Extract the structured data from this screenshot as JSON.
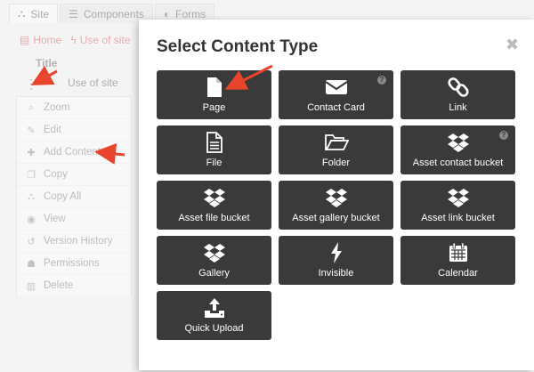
{
  "tabs": [
    {
      "label": "Site",
      "icon": "sitemap-icon"
    },
    {
      "label": "Components",
      "icon": "list-icon"
    },
    {
      "label": "Forms",
      "icon": "toggle-icon"
    }
  ],
  "breadcrumb": [
    {
      "label": "Home",
      "icon": "document-icon"
    },
    {
      "label": "Use of site",
      "icon": "bolt-icon"
    }
  ],
  "table": {
    "column_title": "Title",
    "row_title": "Use of site"
  },
  "context_menu": [
    {
      "label": "Zoom",
      "icon": "zoom-icon"
    },
    {
      "label": "Edit",
      "icon": "pencil-icon"
    },
    {
      "label": "Add Content",
      "icon": "plus-icon"
    },
    {
      "label": "Copy",
      "icon": "copy-icon"
    },
    {
      "label": "Copy All",
      "icon": "sitemap-icon"
    },
    {
      "label": "View",
      "icon": "eye-icon"
    },
    {
      "label": "Version History",
      "icon": "history-icon"
    },
    {
      "label": "Permissions",
      "icon": "users-icon"
    },
    {
      "label": "Delete",
      "icon": "trash-icon"
    }
  ],
  "modal": {
    "title": "Select Content Type",
    "close": "✖",
    "types": [
      {
        "label": "Page",
        "icon": "page-icon",
        "help": false
      },
      {
        "label": "Contact Card",
        "icon": "envelope-icon",
        "help": true
      },
      {
        "label": "Link",
        "icon": "link-icon",
        "help": false
      },
      {
        "label": "File",
        "icon": "file-icon",
        "help": false
      },
      {
        "label": "Folder",
        "icon": "folder-icon",
        "help": false
      },
      {
        "label": "Asset contact bucket",
        "icon": "dropbox-icon",
        "help": true
      },
      {
        "label": "Asset file bucket",
        "icon": "dropbox-icon",
        "help": false
      },
      {
        "label": "Asset gallery bucket",
        "icon": "dropbox-icon",
        "help": false
      },
      {
        "label": "Asset link bucket",
        "icon": "dropbox-icon",
        "help": false
      },
      {
        "label": "Gallery",
        "icon": "dropbox-icon",
        "help": false
      },
      {
        "label": "Invisible",
        "icon": "bolt-icon",
        "help": false
      },
      {
        "label": "Calendar",
        "icon": "calendar-icon",
        "help": false
      },
      {
        "label": "Quick Upload",
        "icon": "upload-icon",
        "help": false
      }
    ]
  },
  "colors": {
    "accent": "#d9534f",
    "tile": "#3a3a3a",
    "arrow": "#e8452c"
  }
}
